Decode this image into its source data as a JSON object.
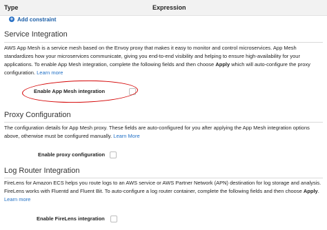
{
  "table_header": {
    "type": "Type",
    "expression": "Expression"
  },
  "add_constraint": "Add constraint",
  "service_integration": {
    "title": "Service Integration",
    "desc_text": "AWS App Mesh is a service mesh based on the Envoy proxy that makes it easy to monitor and control microservices. App Mesh standardizes how your microservices communicate, giving you end-to-end visibility and helping to ensure high-availability for your applications. To enable App Mesh integration, complete the following fields and then choose ",
    "desc_bold": "Apply",
    "desc_after": " which will auto-configure the proxy configuration. ",
    "learn_more": "Learn more",
    "field_label": "Enable App Mesh integration",
    "checked": false
  },
  "proxy_configuration": {
    "title": "Proxy Configuration",
    "desc_text": "The configuration details for App Mesh proxy. These fields are auto-configured for you after applying the App Mesh integration options above, otherwise must be configured manually. ",
    "learn_more": "Learn More",
    "field_label": "Enable proxy configuration",
    "checked": false
  },
  "log_router": {
    "title": "Log Router Integration",
    "desc_text": "FireLens for Amazon ECS helps you route logs to an AWS service or AWS Partner Network (APN) destination for log storage and analysis. FireLens works with Fluentd and Fluent Bit. To auto-configure a log router container, complete the following fields and then choose ",
    "desc_bold": "Apply",
    "desc_after": ". ",
    "learn_more": "Learn more",
    "field_label": "Enable FireLens integration",
    "checked": false
  },
  "colors": {
    "link": "#1f6fc5",
    "annotation": "#d40000"
  }
}
